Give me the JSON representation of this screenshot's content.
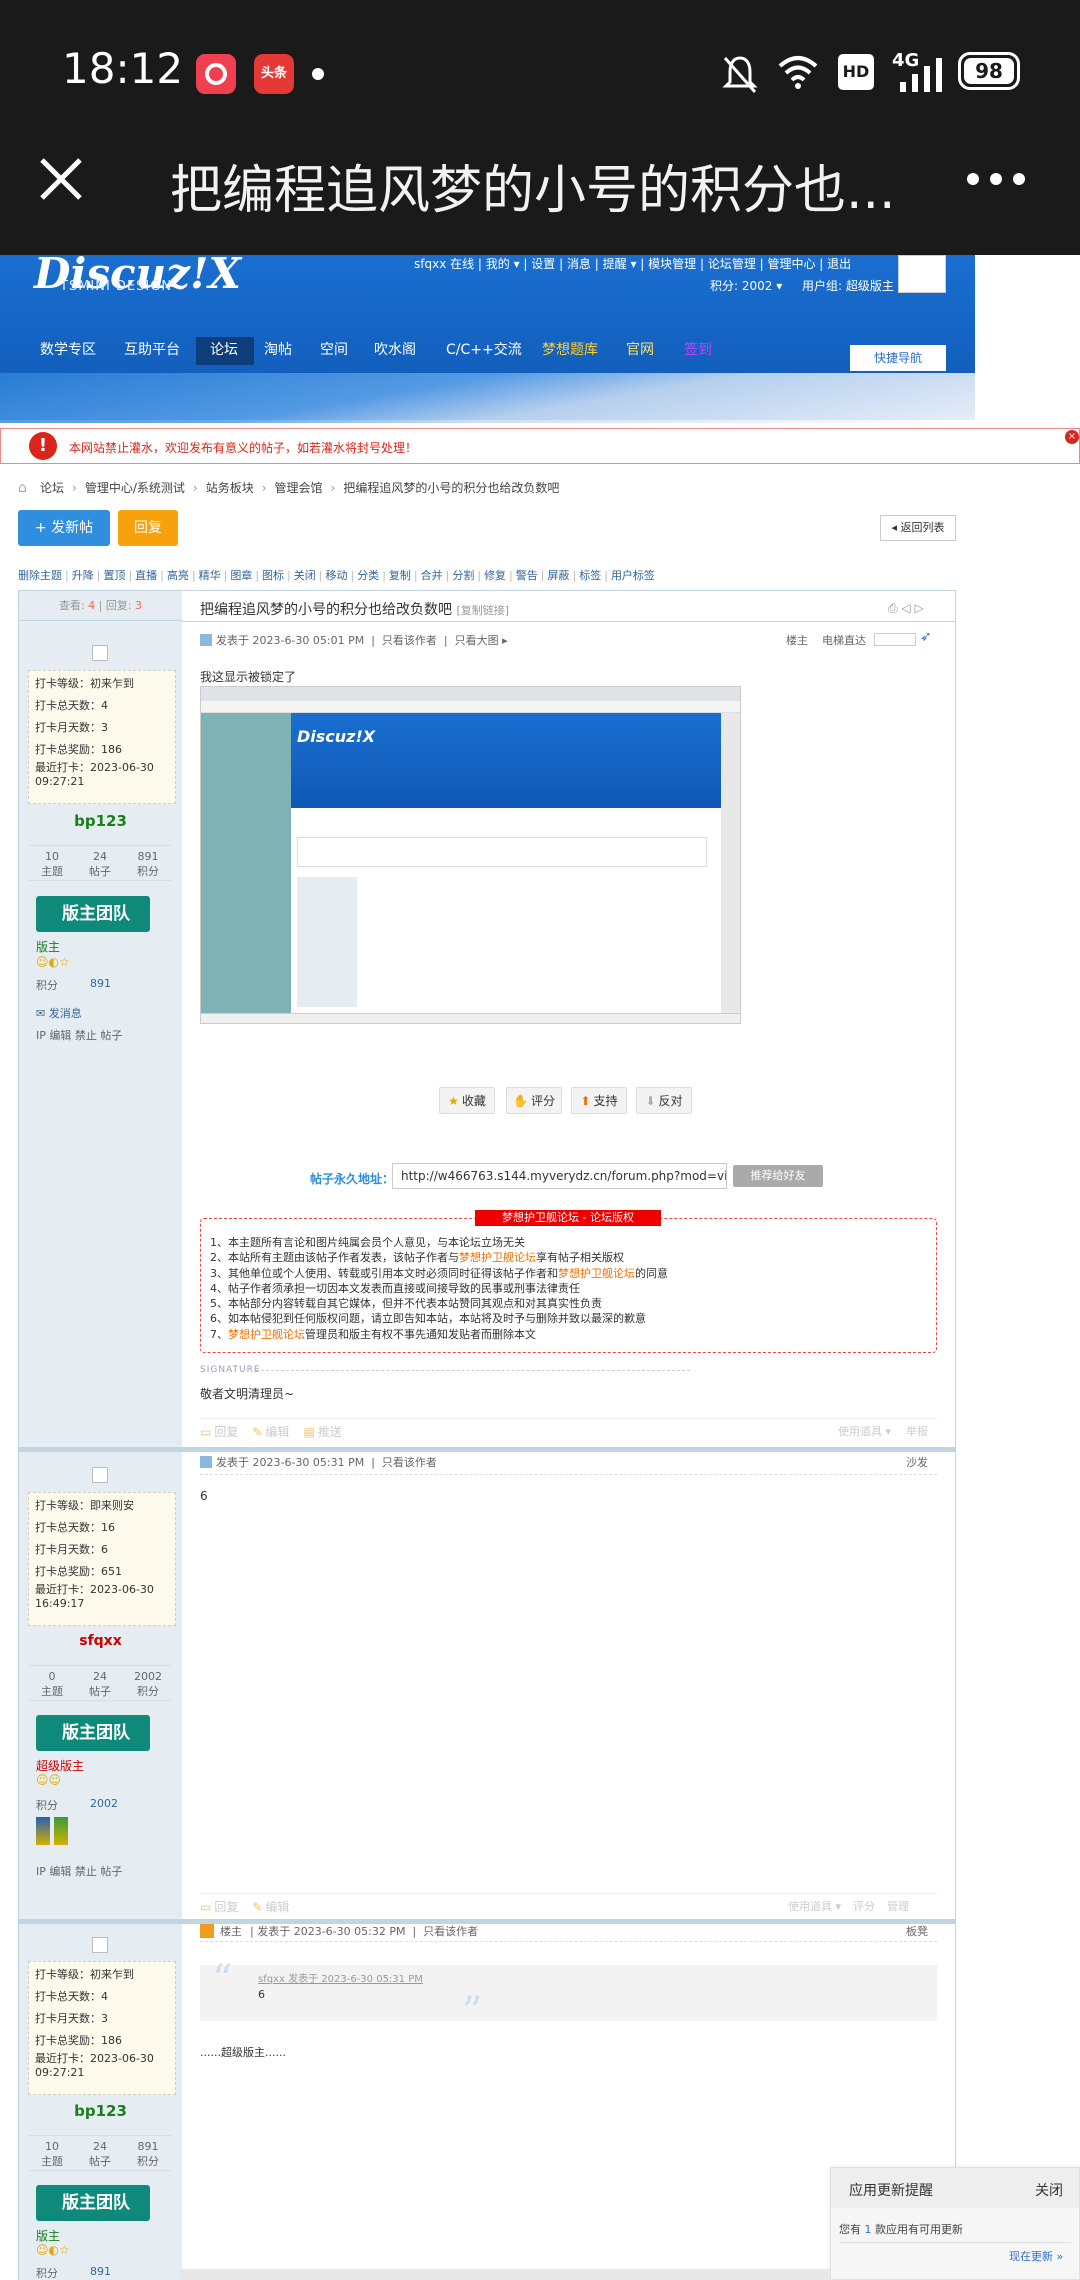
{
  "status_bar": {
    "time": "18:12",
    "battery": "98",
    "network": "4G",
    "hd": "HD",
    "app_icon_1": "camera-app-icon",
    "app_icon_2_label": "头条"
  },
  "titlebar": {
    "title": "把编程追风梦的小号的积分也...",
    "close": "close-icon",
    "more": "more-icon"
  },
  "header": {
    "logo": "Discuz!X",
    "logo_sub": "TSMINI DESIGN",
    "user_links": "sfqxx 在线 | 我的 ▾ | 设置 | 消息 | 提醒 ▾ | 模块管理 | 论坛管理 | 管理中心 | 退出",
    "points": "积分: 2002 ▾",
    "group": "用户组: 超级版主",
    "nav": [
      "数学专区",
      "互助平台",
      "论坛",
      "淘帖",
      "空间",
      "吹水阁",
      "C/C++交流",
      "梦想题库",
      "官网",
      "签到"
    ],
    "quick_nav": "快捷导航"
  },
  "notice": "本网站禁止灌水，欢迎发布有意义的帖子，如若灌水将封号处理！",
  "breadcrumb": [
    "论坛",
    "管理中心/系统测试",
    "站务板块",
    "管理会馆",
    "把编程追风梦的小号的积分也给改负数吧"
  ],
  "actions": {
    "new_post": "+ 发新帖",
    "reply": "回复",
    "back": "返回列表"
  },
  "mod_tools": [
    "删除主题",
    "升降",
    "置顶",
    "直播",
    "高亮",
    "精华",
    "图章",
    "图标",
    "关闭",
    "移动",
    "分类",
    "复制",
    "合并",
    "分割",
    "修复",
    "警告",
    "屏蔽",
    "标签",
    "用户标签"
  ],
  "thread": {
    "views_label": "查看: ",
    "views": "4",
    "replies_label": "回复: ",
    "replies": "3",
    "title": "把编程追风梦的小号的积分也给改负数吧",
    "copy_link": "[复制链接]"
  },
  "posts": [
    {
      "author": "bp123",
      "info": [
        "打卡等级：初来乍到",
        "打卡总天数：4",
        "打卡月天数：3",
        "打卡总奖励：186",
        "最近打卡：2023-06-30 09:27:21"
      ],
      "stats": [
        {
          "v": "10",
          "k": "主题"
        },
        {
          "v": "24",
          "k": "帖子"
        },
        {
          "v": "891",
          "k": "积分"
        }
      ],
      "badge": "版主团队",
      "role": "版主",
      "points_label": "积分",
      "points": "891",
      "pm": "发消息",
      "tools": "IP 编辑 禁止 帖子",
      "meta": "发表于 2023-6-30 05:01 PM  |  只看该作者  |  只看大图 ▸",
      "floor": "楼主",
      "jump": "电梯直达",
      "body": "我这显示被锁定了",
      "buttons": [
        "收藏",
        "评分",
        "支持",
        "反对"
      ],
      "permalink_label": "帖子永久地址：",
      "permalink": "http://w466763.s144.myverydz.cn/forum.php?mod=view",
      "recommend": "推荐给好友",
      "copyright_title": "梦想护卫舰论坛 - 论坛版权",
      "copyright": [
        "1、本主题所有言论和图片纯属会员个人意见，与本论坛立场无关",
        "2、本站所有主题由该帖子作者发表，该帖子作者与梦想护卫舰论坛享有帖子相关版权",
        "3、其他单位或个人使用、转载或引用本文时必须同时征得该帖子作者和梦想护卫舰论坛的同意",
        "4、帖子作者须承担一切因本文发表而直接或间接导致的民事或刑事法律责任",
        "5、本帖部分内容转载自其它媒体，但并不代表本站赞同其观点和对其真实性负责",
        "6、如本帖侵犯到任何版权问题，请立即告知本站，本站将及时予与删除并致以最深的歉意",
        "7、梦想护卫舰论坛管理员和版主有权不事先通知发贴者而删除本文"
      ],
      "signature_label": "SIGNATURE",
      "signature": "敬者文明清理员~",
      "footer": [
        "回复",
        "编辑",
        "推送"
      ],
      "footer_right": [
        "使用道具 ▾",
        "举报"
      ]
    },
    {
      "author": "sfqxx",
      "info": [
        "打卡等级：即来则安",
        "打卡总天数：16",
        "打卡月天数：6",
        "打卡总奖励：651",
        "最近打卡：2023-06-30 16:49:17"
      ],
      "stats": [
        {
          "v": "0",
          "k": "主题"
        },
        {
          "v": "24",
          "k": "帖子"
        },
        {
          "v": "2002",
          "k": "积分"
        }
      ],
      "badge": "版主团队",
      "role": "超级版主",
      "points_label": "积分",
      "points": "2002",
      "tools": "IP 编辑 禁止 帖子",
      "meta": "发表于 2023-6-30 05:31 PM  |  只看该作者",
      "floor": "沙发",
      "body": "6",
      "footer": [
        "回复",
        "编辑"
      ],
      "footer_right": [
        "使用道具 ▾",
        "评分",
        "管理"
      ]
    },
    {
      "author": "bp123",
      "info": [
        "打卡等级：初来乍到",
        "打卡总天数：4",
        "打卡月天数：3",
        "打卡总奖励：186",
        "最近打卡：2023-06-30 09:27:21"
      ],
      "stats": [
        {
          "v": "10",
          "k": "主题"
        },
        {
          "v": "24",
          "k": "帖子"
        },
        {
          "v": "891",
          "k": "积分"
        }
      ],
      "badge": "版主团队",
      "role": "版主",
      "points_label": "积分",
      "points": "891",
      "meta_prefix": "楼主",
      "meta": "发表于 2023-6-30 05:32 PM  |  只看该作者",
      "floor": "板凳",
      "quote_head": "sfqxx 发表于 2023-6-30 05:31 PM",
      "quote_body": "6",
      "body": "......超级版主......"
    }
  ],
  "update_popup": {
    "title": "应用更新提醒",
    "close": "关闭",
    "text_pre": "您有",
    "count": "1",
    "text_post": "款应用有可用更新",
    "action": "现在更新 »"
  },
  "colors": {
    "header_blue": "#1565c0",
    "nav_active": "#0d3d7a",
    "side_bg": "#e5edf2",
    "badge": "#0f8a7a",
    "author_green": "#1a7f1a",
    "author_red": "#cc0000",
    "accent_orange": "#f7a10c",
    "btn_blue": "#2f8fde"
  }
}
